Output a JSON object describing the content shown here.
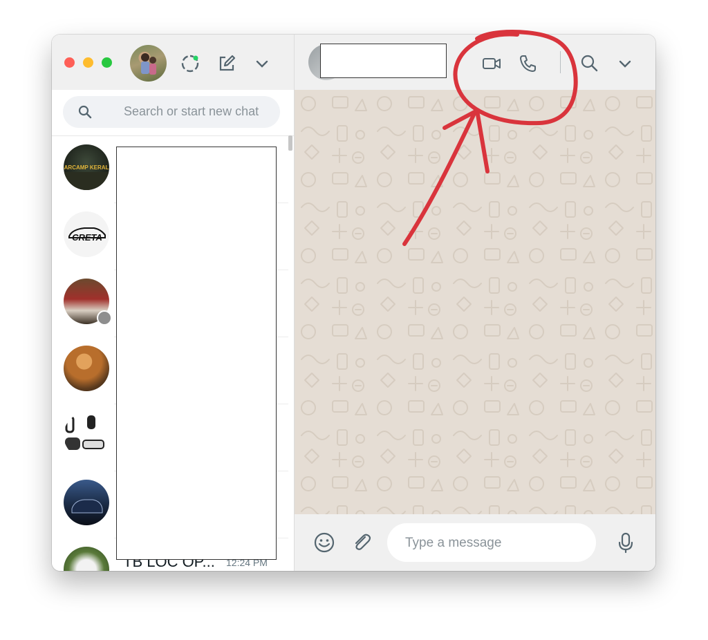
{
  "window": {
    "traffic_lights": {
      "close": "#fe5f57",
      "minimize": "#febc2e",
      "zoom": "#28c840"
    }
  },
  "left_header": {
    "icons": [
      "status-icon",
      "new-chat-icon",
      "chevron-down-icon"
    ],
    "status_dot_color": "#25d366"
  },
  "search": {
    "placeholder": "Search or start new chat",
    "icon": "search-icon"
  },
  "chats": {
    "items": [
      {
        "avatar_text": "BARCAMP KERALA"
      },
      {
        "avatar_text": "CRETA"
      },
      {
        "avatar_text": ""
      },
      {
        "avatar_text": ""
      },
      {
        "avatar_text": ""
      },
      {
        "avatar_text": ""
      },
      {
        "name": "TB LOC OP...",
        "time": "12:24 PM"
      }
    ]
  },
  "right_header": {
    "icons": [
      "video-call-icon",
      "voice-call-icon",
      "search-icon",
      "chevron-down-icon"
    ]
  },
  "composer": {
    "placeholder": "Type a message",
    "icons": [
      "emoji-icon",
      "attach-icon",
      "microphone-icon"
    ]
  },
  "annotation": {
    "color": "#d9343c",
    "shape": "circle-and-arrow"
  }
}
